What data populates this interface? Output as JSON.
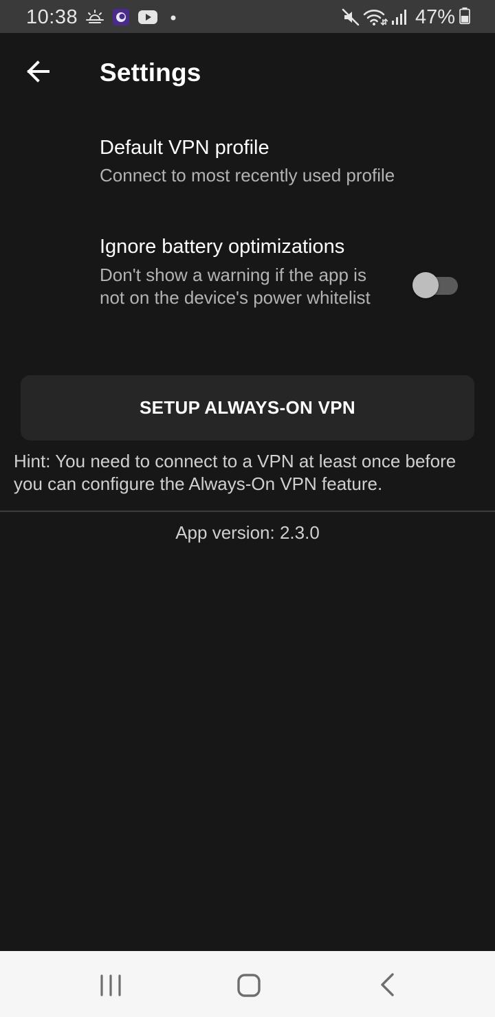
{
  "status_bar": {
    "time": "10:38",
    "battery_percent": "47%",
    "icons": [
      "weather-icon",
      "app-notification-icon",
      "youtube-icon",
      "dot-icon",
      "mute-icon",
      "wifi-icon",
      "signal-icon",
      "battery-icon"
    ]
  },
  "app_bar": {
    "title": "Settings",
    "back_icon": "arrow-left-icon"
  },
  "preferences": {
    "default_vpn": {
      "title": "Default VPN profile",
      "summary": "Connect to most recently used profile"
    },
    "ignore_battery": {
      "title": "Ignore battery optimizations",
      "summary": "Don't show a warning if the app is not on the device's power whitelist",
      "enabled": false
    }
  },
  "setup_button": {
    "label": "SETUP ALWAYS-ON VPN"
  },
  "hint": "Hint: You need to connect to a VPN at least once before you can configure the Always-On VPN feature.",
  "app_version": "App version: 2.3.0",
  "nav_bar": {
    "icons": [
      "recent-apps-icon",
      "home-icon",
      "back-icon"
    ]
  },
  "colors": {
    "background": "#171717",
    "status_bar": "#3a3a3a",
    "button": "#262626",
    "nav_bar": "#f6f6f6"
  }
}
